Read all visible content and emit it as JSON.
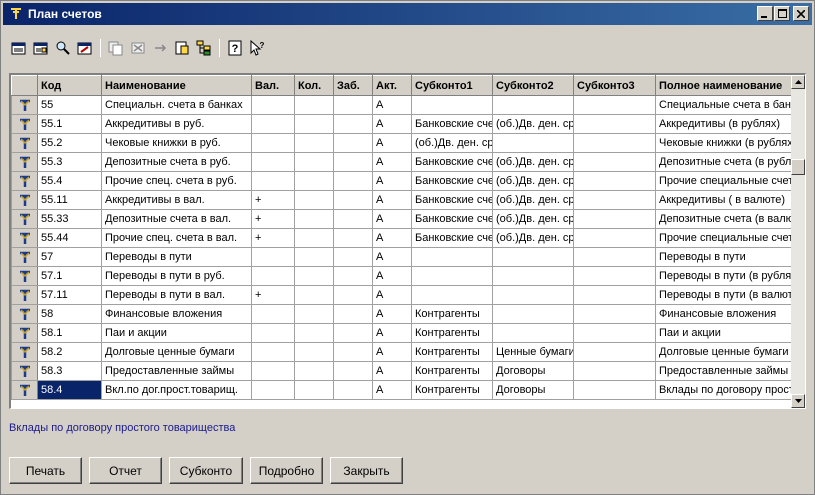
{
  "window": {
    "title": "План счетов"
  },
  "toolbar": {
    "buttons": [
      "new-account-icon",
      "new-group-icon",
      "find-icon",
      "edit-icon",
      "copy-icon",
      "delete-icon",
      "move-icon",
      "mark-icon",
      "hierarchy-icon",
      "help-icon",
      "context-help-icon"
    ]
  },
  "grid": {
    "columns": [
      "",
      "Код",
      "Наименование",
      "Вал.",
      "Кол.",
      "Заб.",
      "Акт.",
      "Субконто1",
      "Субконто2",
      "Субконто3",
      "Полное наименование"
    ],
    "rows": [
      {
        "code": "55",
        "name": "Специальн. счета в банках",
        "val": "",
        "kol": "",
        "zab": "",
        "akt": "А",
        "s1": "",
        "s2": "",
        "s3": "",
        "full": "Специальные счета в банках"
      },
      {
        "code": "55.1",
        "name": "Аккредитивы в руб.",
        "val": "",
        "kol": "",
        "zab": "",
        "akt": "А",
        "s1": "Банковские счета",
        "s2": "(об.)Дв. ден. средств",
        "s3": "",
        "full": "Аккредитивы (в рублях)"
      },
      {
        "code": "55.2",
        "name": "Чековые книжки в руб.",
        "val": "",
        "kol": "",
        "zab": "",
        "akt": "А",
        "s1": "(об.)Дв. ден. средств",
        "s2": "",
        "s3": "",
        "full": "Чековые книжки (в рублях)"
      },
      {
        "code": "55.3",
        "name": "Депозитные счета в руб.",
        "val": "",
        "kol": "",
        "zab": "",
        "akt": "А",
        "s1": "Банковские счета",
        "s2": "(об.)Дв. ден. средств",
        "s3": "",
        "full": "Депозитные счета (в рублях)"
      },
      {
        "code": "55.4",
        "name": "Прочие спец. счета в руб.",
        "val": "",
        "kol": "",
        "zab": "",
        "akt": "А",
        "s1": "Банковские счета",
        "s2": "(об.)Дв. ден. средств",
        "s3": "",
        "full": "Прочие специальные счета"
      },
      {
        "code": "55.11",
        "name": "Аккредитивы в вал.",
        "val": "+",
        "kol": "",
        "zab": "",
        "akt": "А",
        "s1": "Банковские счета",
        "s2": "(об.)Дв. ден. средств",
        "s3": "",
        "full": "Аккредитивы ( в валюте)"
      },
      {
        "code": "55.33",
        "name": "Депозитные счета в вал.",
        "val": "+",
        "kol": "",
        "zab": "",
        "akt": "А",
        "s1": "Банковские счета",
        "s2": "(об.)Дв. ден. средств",
        "s3": "",
        "full": "Депозитные счета (в валюте)"
      },
      {
        "code": "55.44",
        "name": "Прочие спец. счета в вал.",
        "val": "+",
        "kol": "",
        "zab": "",
        "akt": "А",
        "s1": "Банковские счета",
        "s2": "(об.)Дв. ден. средств",
        "s3": "",
        "full": "Прочие специальные счета"
      },
      {
        "code": "57",
        "name": "Переводы в пути",
        "val": "",
        "kol": "",
        "zab": "",
        "akt": "А",
        "s1": "",
        "s2": "",
        "s3": "",
        "full": "Переводы в пути"
      },
      {
        "code": "57.1",
        "name": "Переводы в пути в руб.",
        "val": "",
        "kol": "",
        "zab": "",
        "akt": "А",
        "s1": "",
        "s2": "",
        "s3": "",
        "full": "Переводы в пути (в рублях)"
      },
      {
        "code": "57.11",
        "name": "Переводы в пути в вал.",
        "val": "+",
        "kol": "",
        "zab": "",
        "akt": "А",
        "s1": "",
        "s2": "",
        "s3": "",
        "full": "Переводы в пути (в валюте)"
      },
      {
        "code": "58",
        "name": "Финансовые вложения",
        "val": "",
        "kol": "",
        "zab": "",
        "akt": "А",
        "s1": "Контрагенты",
        "s2": "",
        "s3": "",
        "full": "Финансовые вложения"
      },
      {
        "code": "58.1",
        "name": "Паи и акции",
        "val": "",
        "kol": "",
        "zab": "",
        "akt": "А",
        "s1": "Контрагенты",
        "s2": "",
        "s3": "",
        "full": "Паи и акции"
      },
      {
        "code": "58.2",
        "name": "Долговые ценные бумаги",
        "val": "",
        "kol": "",
        "zab": "",
        "akt": "А",
        "s1": "Контрагенты",
        "s2": "Ценные бумаги",
        "s3": "",
        "full": "Долговые ценные бумаги"
      },
      {
        "code": "58.3",
        "name": "Предоставленные займы",
        "val": "",
        "kol": "",
        "zab": "",
        "akt": "А",
        "s1": "Контрагенты",
        "s2": "Договоры",
        "s3": "",
        "full": "Предоставленные займы"
      },
      {
        "code": "58.4",
        "name": "Вкл.по дог.прост.товарищ.",
        "val": "",
        "kol": "",
        "zab": "",
        "akt": "А",
        "s1": "Контрагенты",
        "s2": "Договоры",
        "s3": "",
        "full": "Вклады по договору простого товарищества"
      }
    ],
    "selected_code": "58.4"
  },
  "status": {
    "text": "Вклады по договору простого товарищества"
  },
  "buttons": {
    "print": "Печать",
    "report": "Отчет",
    "subconto": "Субконто",
    "details": "Подробно",
    "close": "Закрыть"
  },
  "colors": {
    "titlebar": "#0a246a",
    "selection": "#0a246a",
    "status_text": "#1a1a8c",
    "face": "#d4d0c8"
  }
}
